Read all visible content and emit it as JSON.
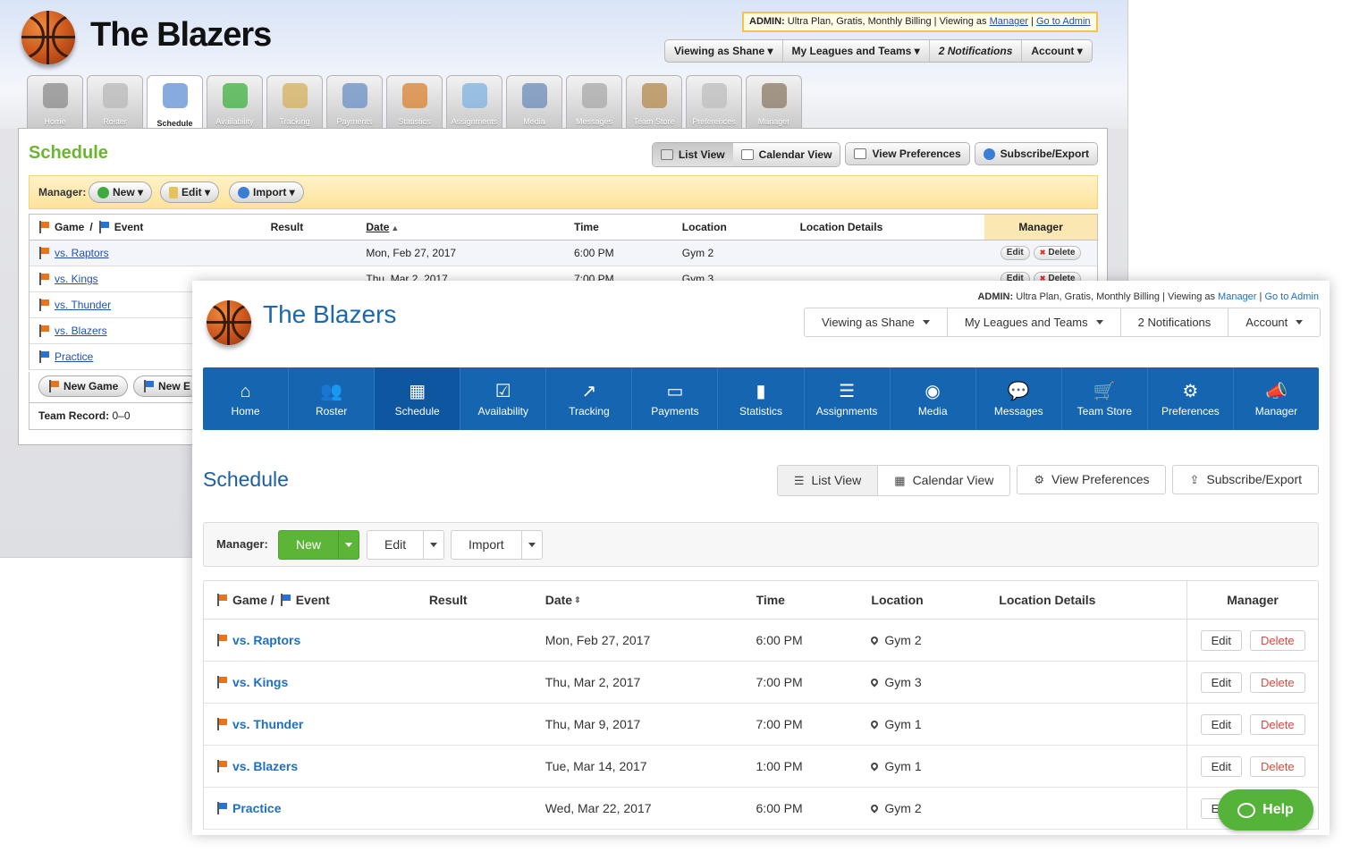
{
  "old_ui": {
    "team_name": "The Blazers",
    "admin_bar": {
      "prefix": "ADMIN:",
      "text": "Ultra Plan, Gratis, Monthly Billing | Viewing as",
      "manager_link": "Manager",
      "separator": "|",
      "go_admin": "Go to Admin"
    },
    "account_menu": [
      "Viewing as Shane ▾",
      "My Leagues and Teams ▾",
      "2 Notifications",
      "Account ▾"
    ],
    "tabs": [
      {
        "label": "Home",
        "color": "#8b8b8b"
      },
      {
        "label": "Roster",
        "color": "#b8b8b8"
      },
      {
        "label": "Schedule",
        "color": "#5f8fd0"
      },
      {
        "label": "Availability",
        "color": "#3fb13f"
      },
      {
        "label": "Tracking",
        "color": "#d6b05c"
      },
      {
        "label": "Payments",
        "color": "#6a8fc6"
      },
      {
        "label": "Statistics",
        "color": "#d9832f"
      },
      {
        "label": "Assignments",
        "color": "#7fb3e0"
      },
      {
        "label": "Media",
        "color": "#6b8bb8"
      },
      {
        "label": "Messages",
        "color": "#a8a8a8"
      },
      {
        "label": "Team Store",
        "color": "#b48a4e"
      },
      {
        "label": "Preferences",
        "color": "#bdbdbd"
      },
      {
        "label": "Manager",
        "color": "#8c7a66"
      }
    ],
    "page_title": "Schedule",
    "view_buttons": {
      "list": "List View",
      "calendar": "Calendar View",
      "prefs": "View Preferences",
      "subscribe": "Subscribe/Export"
    },
    "manager_bar": {
      "label": "Manager:",
      "new": "New ▾",
      "edit": "Edit ▾",
      "import": "Import ▾"
    },
    "table": {
      "headers": {
        "game": "Game",
        "slash": "/",
        "event": "Event",
        "result": "Result",
        "date": "Date",
        "time": "Time",
        "location": "Location",
        "location_details": "Location Details",
        "manager": "Manager"
      },
      "rows": [
        {
          "name": "vs. Raptors",
          "type": "game",
          "date": "Mon, Feb 27, 2017",
          "time": "6:00 PM",
          "location": "Gym 2"
        },
        {
          "name": "vs. Kings",
          "type": "game",
          "date": "Thu, Mar 2, 2017",
          "time": "7:00 PM",
          "location": "Gym 3"
        },
        {
          "name": "vs. Thunder",
          "type": "game"
        },
        {
          "name": "vs. Blazers",
          "type": "game"
        },
        {
          "name": "Practice",
          "type": "event"
        }
      ],
      "edit_label": "Edit",
      "delete_label": "Delete"
    },
    "bottom": {
      "new_game": "New Game",
      "new_event": "New E",
      "team_record_label": "Team Record:",
      "team_record_value": "0–0"
    }
  },
  "new_ui": {
    "team_name": "The Blazers",
    "admin_bar": {
      "prefix": "ADMIN:",
      "text": "Ultra Plan, Gratis, Monthly Billing | Viewing as",
      "manager_link": "Manager",
      "separator": "|",
      "go_admin": "Go to Admin"
    },
    "account_menu": {
      "viewing": "Viewing as Shane",
      "leagues": "My Leagues and Teams",
      "notifications": "2 Notifications",
      "account": "Account"
    },
    "nav": [
      {
        "label": "Home",
        "icon": "⌂"
      },
      {
        "label": "Roster",
        "icon": "👥"
      },
      {
        "label": "Schedule",
        "icon": "▦"
      },
      {
        "label": "Availability",
        "icon": "☑"
      },
      {
        "label": "Tracking",
        "icon": "↗"
      },
      {
        "label": "Payments",
        "icon": "▭"
      },
      {
        "label": "Statistics",
        "icon": "▮"
      },
      {
        "label": "Assignments",
        "icon": "☰"
      },
      {
        "label": "Media",
        "icon": "◉"
      },
      {
        "label": "Messages",
        "icon": "💬"
      },
      {
        "label": "Team Store",
        "icon": "🛒"
      },
      {
        "label": "Preferences",
        "icon": "⚙"
      },
      {
        "label": "Manager",
        "icon": "📣"
      }
    ],
    "page_title": "Schedule",
    "view_buttons": {
      "list": "List View",
      "calendar": "Calendar View",
      "prefs": "View Preferences",
      "subscribe": "Subscribe/Export"
    },
    "manager_bar": {
      "label": "Manager:",
      "new": "New",
      "edit": "Edit",
      "import": "Import"
    },
    "table": {
      "headers": {
        "game": "Game /",
        "event": "Event",
        "result": "Result",
        "date": "Date",
        "time": "Time",
        "location": "Location",
        "location_details": "Location Details",
        "manager": "Manager"
      },
      "rows": [
        {
          "name": "vs. Raptors",
          "type": "game",
          "date": "Mon, Feb 27, 2017",
          "time": "6:00 PM",
          "location": "Gym 2"
        },
        {
          "name": "vs. Kings",
          "type": "game",
          "date": "Thu, Mar 2, 2017",
          "time": "7:00 PM",
          "location": "Gym 3"
        },
        {
          "name": "vs. Thunder",
          "type": "game",
          "date": "Thu, Mar 9, 2017",
          "time": "7:00 PM",
          "location": "Gym 1"
        },
        {
          "name": "vs. Blazers",
          "type": "game",
          "date": "Tue, Mar 14, 2017",
          "time": "1:00 PM",
          "location": "Gym 1"
        },
        {
          "name": "Practice",
          "type": "event",
          "date": "Wed, Mar 22, 2017",
          "time": "6:00 PM",
          "location": "Gym 2"
        }
      ],
      "edit_label": "Edit",
      "delete_label": "Delete"
    },
    "help_label": "Help"
  }
}
